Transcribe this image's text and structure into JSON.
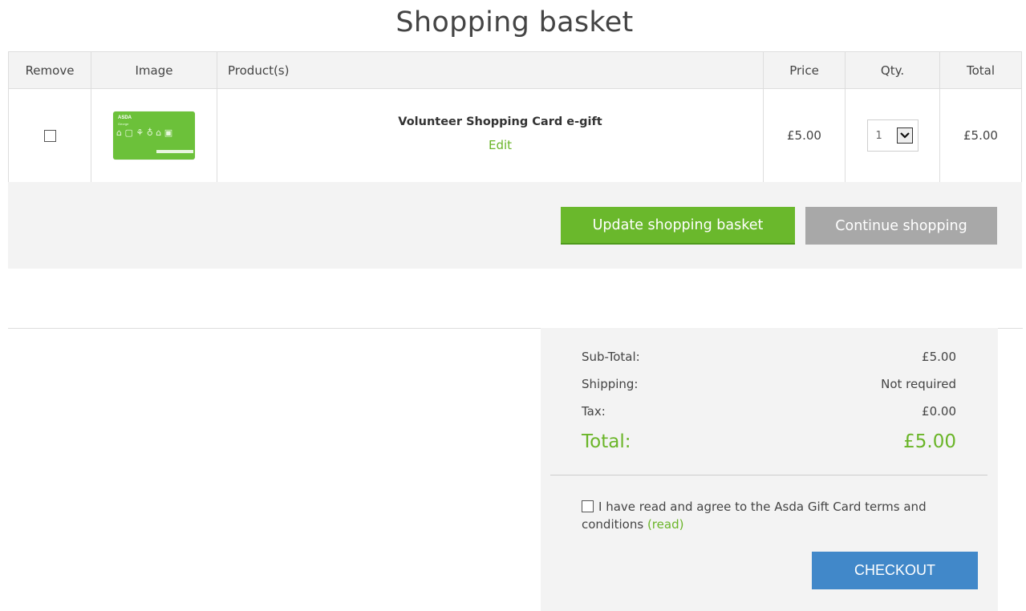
{
  "page": {
    "title": "Shopping basket"
  },
  "table": {
    "headers": {
      "remove": "Remove",
      "image": "Image",
      "product": "Product(s)",
      "price": "Price",
      "qty": "Qty.",
      "total": "Total"
    },
    "rows": [
      {
        "product_name": "Volunteer Shopping Card e-gift",
        "edit_label": "Edit",
        "price": "£5.00",
        "qty": "1",
        "total": "£5.00",
        "card_brand": "ASDA",
        "card_sub": "George"
      }
    ]
  },
  "actions": {
    "update_label": "Update shopping basket",
    "continue_label": "Continue shopping"
  },
  "totals": {
    "subtotal_label": "Sub-Total:",
    "subtotal_value": "£5.00",
    "shipping_label": "Shipping:",
    "shipping_value": "Not required",
    "tax_label": "Tax:",
    "tax_value": "£0.00",
    "total_label": "Total:",
    "total_value": "£5.00"
  },
  "terms": {
    "text": "I have read and agree to the Asda Gift Card terms and conditions",
    "link": "(read)"
  },
  "checkout": {
    "label": "CHECKOUT"
  },
  "colors": {
    "accent_green": "#6ab528",
    "button_green": "#6ab82c",
    "button_grey": "#a8a8a8",
    "checkout_blue": "#4188c9"
  }
}
